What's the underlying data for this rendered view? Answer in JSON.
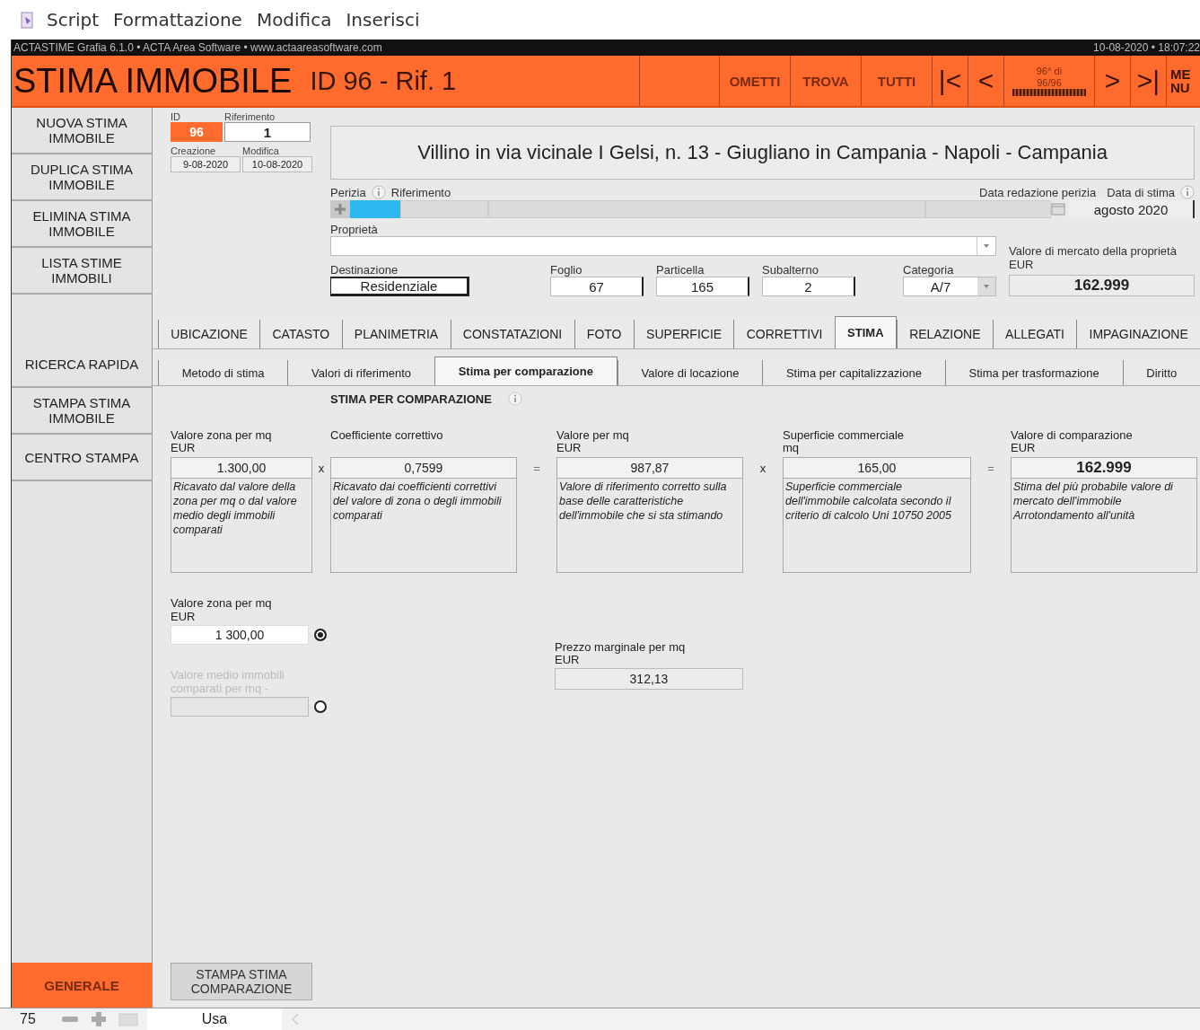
{
  "menu": [
    "Script",
    "Formattazione",
    "Modifica",
    "Inserisci"
  ],
  "app_bar": {
    "info": "ACTASTIME Grafia 6.1.0 • ACTA Area Software • www.actaareasoftware.com",
    "datetime": "10-08-2020 • 18:07:22"
  },
  "header": {
    "title": "STIMA IMMOBILE",
    "subtitle": "ID 96 - Rif. 1",
    "buttons": [
      "OMETTI",
      "TROVA",
      "TUTTI"
    ],
    "nav_first": "|<",
    "nav_prev": "<",
    "record_position": "96° di",
    "record_count": "96/96",
    "nav_next": ">",
    "nav_last": ">|",
    "menu_button": "ME NU"
  },
  "sidebar": {
    "groups": [
      [
        {
          "label": "NUOVA STIMA IMMOBILE"
        },
        {
          "label": "DUPLICA STIMA IMMOBILE"
        },
        {
          "label": "ELIMINA STIMA IMMOBILE"
        },
        {
          "label": "LISTA STIME IMMOBILI"
        }
      ],
      [
        {
          "label": "RICERCA RAPIDA"
        },
        {
          "label": "STAMPA STIMA IMMOBILE"
        },
        {
          "label": "CENTRO STAMPA"
        }
      ]
    ],
    "footer_button": "GENERALE"
  },
  "record": {
    "id_label": "ID",
    "id": "96",
    "ref_label": "Riferimento",
    "ref": "1",
    "created_label": "Creazione",
    "created": "9-08-2020",
    "modified_label": "Modifica",
    "modified": "10-08-2020"
  },
  "address": "Villino in via vicinale I Gelsi, n. 13 - Giugliano in Campania - Napoli - Campania",
  "perizia": {
    "label": "Perizia",
    "ref_label": "Riferimento",
    "date_label": "Data redazione perizia",
    "estimate_date_label": "Data di stima",
    "estimate_date": "agosto 2020"
  },
  "property": {
    "label": "Proprietà"
  },
  "market_value": {
    "label": "Valore di mercato della proprietà",
    "unit": "EUR",
    "value": "162.999"
  },
  "details": [
    {
      "label": "Destinazione",
      "value": "Residenziale",
      "kind": "select"
    },
    {
      "label": "Foglio",
      "value": "67",
      "kind": "text"
    },
    {
      "label": "Particella",
      "value": "165",
      "kind": "text"
    },
    {
      "label": "Subalterno",
      "value": "2",
      "kind": "text"
    },
    {
      "label": "Categoria",
      "value": "A/7",
      "kind": "dropdown"
    }
  ],
  "tabs": [
    {
      "label": "UBICAZIONE",
      "selected": false
    },
    {
      "label": "CATASTO",
      "selected": false
    },
    {
      "label": "PLANIMETRIA",
      "selected": false
    },
    {
      "label": "CONSTATAZIONI",
      "selected": false
    },
    {
      "label": "FOTO",
      "selected": false
    },
    {
      "label": "SUPERFICIE",
      "selected": false
    },
    {
      "label": "CORRETTIVI",
      "selected": false
    },
    {
      "label": "STIMA",
      "selected": true
    },
    {
      "label": "RELAZIONE",
      "selected": false
    },
    {
      "label": "ALLEGATI",
      "selected": false
    },
    {
      "label": "IMPAGINAZIONE",
      "selected": false
    }
  ],
  "subtabs": [
    {
      "label": "Metodo di stima",
      "selected": false
    },
    {
      "label": "Valori di riferimento",
      "selected": false
    },
    {
      "label": "Stima per comparazione",
      "selected": true
    },
    {
      "label": "Valore di locazione",
      "selected": false
    },
    {
      "label": "Stima per capitalizzazione",
      "selected": false
    },
    {
      "label": "Stima per trasformazione",
      "selected": false
    },
    {
      "label": "Diritto",
      "selected": false
    }
  ],
  "section_title": "STIMA PER COMPARAZIONE",
  "calculation": [
    {
      "label": "Valore zona per mq",
      "unit": "EUR",
      "value": "1.300,00",
      "description": "Ricavato dal valore della zona per mq o dal valore medio degli immobili comparati",
      "operator": "x",
      "bold": false
    },
    {
      "label": "Coefficiente correttivo",
      "value": "0,7599",
      "description": "Ricavato dai coefficienti correttivi del valore di zona o degli immobili comparati",
      "operator": "=",
      "bold": false
    },
    {
      "label": "Valore per mq",
      "unit": "EUR",
      "value": "987,87",
      "description": "Valore di riferimento corretto sulla base delle caratteristiche dell'immobile che si sta stimando",
      "operator": "x",
      "bold": false
    },
    {
      "label": "Superficie commerciale",
      "unit": "mq",
      "value": "165,00",
      "description": "Superficie commerciale dell'immobile calcolata secondo il criterio di calcolo Uni 10750 2005",
      "operator": "=",
      "bold": false
    },
    {
      "label": "Valore di comparazione",
      "unit": "EUR",
      "value": "162.999",
      "description": "Stima del più probabile valore di mercato dell'immobile Arrotondamento all'unità",
      "bold": true
    }
  ],
  "choice": {
    "options": [
      {
        "label": "Valore zona per mq",
        "unit": "EUR",
        "value": "1 300,00",
        "selected": true,
        "disabled": false
      },
      {
        "label": "Valore medio immobili comparati per mq -",
        "selected": false,
        "disabled": true
      }
    ]
  },
  "marginal_price": {
    "label": "Prezzo marginale per mq",
    "unit": "EUR",
    "value": "312,13"
  },
  "print_button": "STAMPA STIMA COMPARAZIONE",
  "status_bar": {
    "zoom": "75",
    "mode": "Usa"
  }
}
